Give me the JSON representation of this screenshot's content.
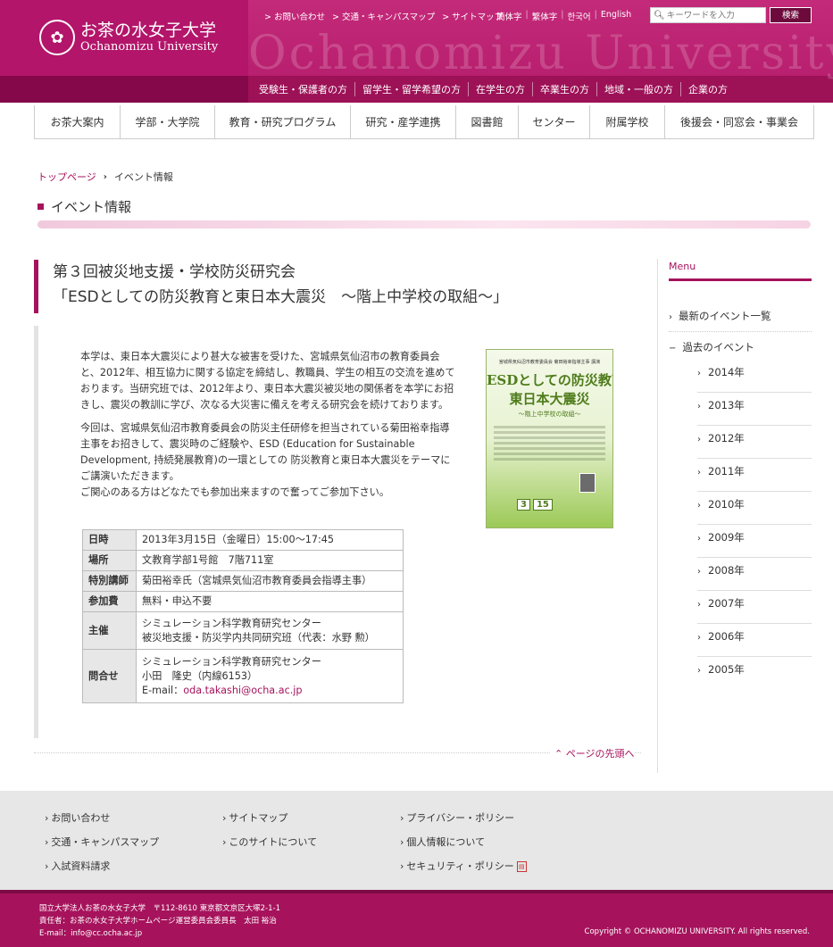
{
  "header": {
    "logo_ja": "お茶の水女子大学",
    "logo_en": "Ochanomizu University",
    "watermark": "Ochanomizu University",
    "util_links": [
      "> お問い合わせ",
      "> 交通・キャンパスマップ",
      "> サイトマップ"
    ],
    "lang_links": [
      "簡体字",
      "繁体字",
      "한국어",
      "English"
    ],
    "search_placeholder": "キーワードを入力",
    "search_button": "検索",
    "audience_nav": [
      "受験生・保護者の方",
      "留学生・留学希望の方",
      "在学生の方",
      "卒業生の方",
      "地域・一般の方",
      "企業の方"
    ]
  },
  "global_nav": [
    "お茶大案内",
    "学部・大学院",
    "教育・研究プログラム",
    "研究・産学連携",
    "図書館",
    "センター",
    "附属学校",
    "後援会・同窓会・事業会"
  ],
  "breadcrumb": {
    "home": "トップページ",
    "current": "イベント情報"
  },
  "page_title": "イベント情報",
  "article": {
    "title_line1": "第３回被災地支援・学校防災研究会",
    "title_line2": "「ESDとしての防災教育と東日本大震災　～階上中学校の取組～」",
    "para1": "本学は、東日本大震災により甚大な被害を受けた、宮城県気仙沼市の教育委員会と、2012年、相互協力に関する協定を締結し、教職員、学生の相互の交流を進めております。当研究班では、2012年より、東日本大震災被災地の関係者を本学にお招きし、震災の教訓に学び、次なる大災害に備えを考える研究会を続けております。",
    "para2": "今回は、宮城県気仙沼市教育委員会の防災主任研修を担当されている菊田裕幸指導主事をお招きして、震災時のご経験や、ESD (Education for Sustainable Development, 持続発展教育)の一環としての 防災教育と東日本大震災をテーマにご講演いただきます。",
    "para3": "ご関心のある方はどなたでも参加出来ますので奮ってご参加下さい。",
    "poster": {
      "top": "宮城県気仙沼市教育委員会 菊田裕幸指導主事 講演",
      "title1": "ESDとしての防災教育と",
      "title2": "東日本大震災",
      "sub": "～階上中学校の取組～",
      "month": "3",
      "day": "15"
    },
    "table": [
      {
        "label": "日時",
        "lines": [
          "2013年3月15日（金曜日）15:00～17:45"
        ]
      },
      {
        "label": "場所",
        "lines": [
          "文教育学部1号館　7階711室"
        ]
      },
      {
        "label": "特別講師",
        "lines": [
          "菊田裕幸氏（宮城県気仙沼市教育委員会指導主事）"
        ]
      },
      {
        "label": "参加費",
        "lines": [
          "無料・申込不要"
        ]
      },
      {
        "label": "主催",
        "lines": [
          "シミュレーション科学教育研究センター",
          "被災地支援・防災学内共同研究班（代表：水野 勲）"
        ]
      },
      {
        "label": "問合せ",
        "lines": [
          "シミュレーション科学教育研究センター",
          "小田　隆史（内線6153）"
        ],
        "email_prefix": "E-mail：",
        "email": "oda.takashi@ocha.ac.jp"
      }
    ],
    "page_top": "ページの先頭へ"
  },
  "sidebar": {
    "heading": "Menu",
    "latest": "最新のイベント一覧",
    "past": "過去のイベント",
    "years": [
      "2014年",
      "2013年",
      "2012年",
      "2011年",
      "2010年",
      "2009年",
      "2008年",
      "2007年",
      "2006年",
      "2005年"
    ]
  },
  "footer": {
    "col1": [
      "お問い合わせ",
      "交通・キャンパスマップ",
      "入試資料請求"
    ],
    "col2": [
      "サイトマップ",
      "このサイトについて"
    ],
    "col3": [
      "プライバシー・ポリシー",
      "個人情報について",
      "セキュリティ・ポリシー"
    ],
    "address_line1": "国立大学法人お茶の水女子大学　〒112-8610 東京都文京区大塚2-1-1",
    "address_line2": "責任者：お茶の水女子大学ホームページ運営委員会委員長　太田 裕治",
    "address_line3": "E-mail：info@cc.ocha.ac.jp",
    "copyright": "Copyright © OCHANOMIZU UNIVERSITY. All rights reserved."
  },
  "colors": {
    "brand": "#a6135c",
    "brand_dark": "#85084a",
    "footer_bg": "#e7e7e7"
  }
}
